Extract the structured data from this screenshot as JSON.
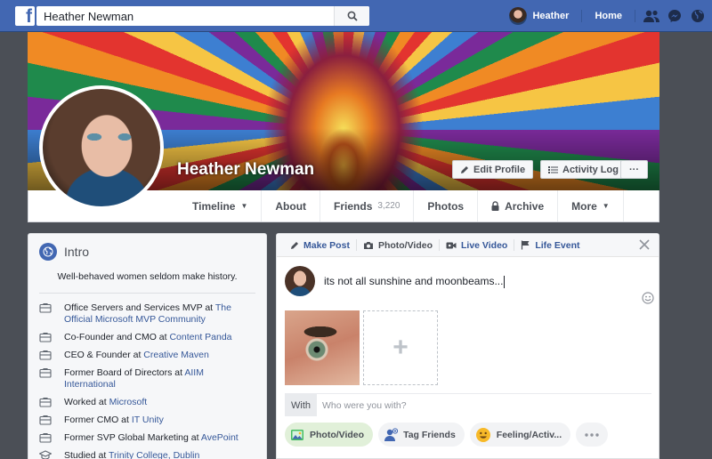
{
  "topbar": {
    "logo": "f",
    "search_value": "Heather Newman",
    "user_name": "Heather",
    "home_label": "Home"
  },
  "profile": {
    "name": "Heather Newman",
    "edit_profile": "Edit Profile",
    "activity_log": "Activity Log",
    "more": "···"
  },
  "nav": {
    "timeline": "Timeline",
    "about": "About",
    "friends": "Friends",
    "friends_count": "3,220",
    "photos": "Photos",
    "archive": "Archive",
    "more": "More"
  },
  "intro": {
    "title": "Intro",
    "bio": "Well-behaved women seldom make history.",
    "items": [
      {
        "text": "Office Servers and Services MVP at ",
        "link": "The Official Microsoft MVP Community"
      },
      {
        "text": "Co-Founder and CMO at ",
        "link": "Content Panda"
      },
      {
        "text": "CEO & Founder at ",
        "link": "Creative Maven"
      },
      {
        "text": "Former Board of Directors at ",
        "link": "AIIM International"
      },
      {
        "text": "Worked at ",
        "link": "Microsoft"
      },
      {
        "text": "Former CMO at ",
        "link": "IT Unity"
      },
      {
        "text": "Former SVP Global Marketing at ",
        "link": "AvePoint"
      },
      {
        "text": "Studied at ",
        "link": "Trinity College, Dublin"
      }
    ]
  },
  "composer": {
    "tabs": {
      "make_post": "Make Post",
      "photo_video": "Photo/Video",
      "live_video": "Live Video",
      "life_event": "Life Event"
    },
    "status_text": "its not all sunshine and moonbeams...",
    "with_label": "With",
    "with_placeholder": "Who were you with?",
    "pills": {
      "photo_video": "Photo/Video",
      "tag_friends": "Tag Friends",
      "feeling": "Feeling/Activ..."
    },
    "add_photo": "+"
  },
  "colors": {
    "brand": "#4267b2",
    "link": "#365899",
    "background": "#4b4f56"
  }
}
